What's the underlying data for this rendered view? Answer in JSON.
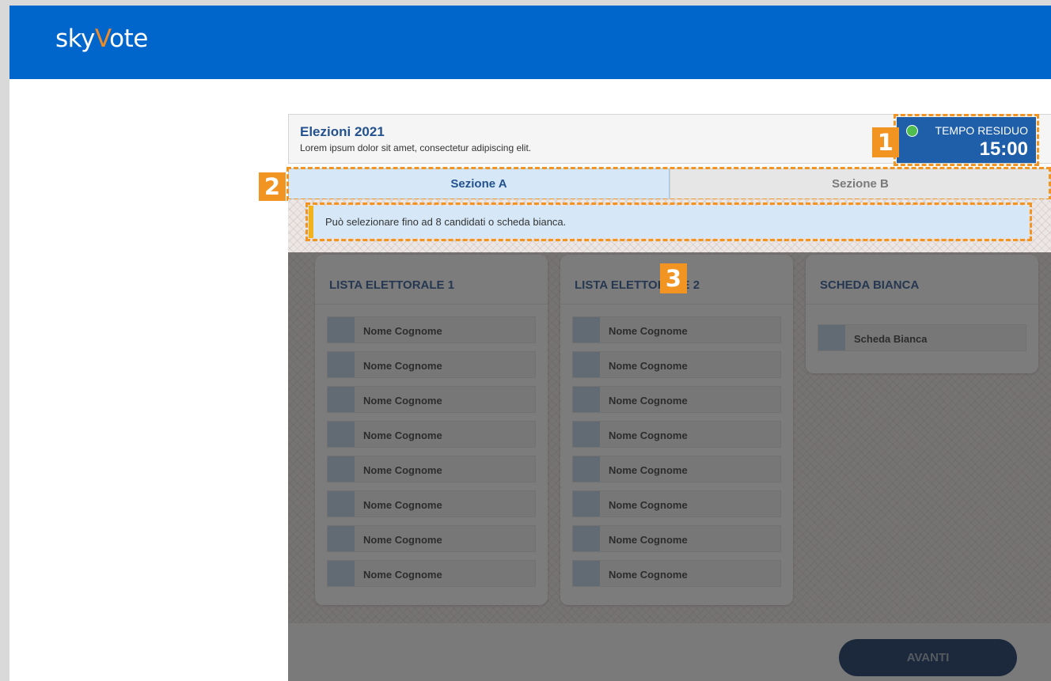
{
  "app": {
    "logo_main": "sky",
    "logo_accent": "V",
    "logo_tail": "ote"
  },
  "election": {
    "title": "Elezioni 2021",
    "subtitle": "Lorem ipsum dolor sit amet, consectetur adipiscing elit."
  },
  "timer": {
    "label": "TEMPO RESIDUO",
    "value": "15:00"
  },
  "tabs": [
    {
      "label": "Sezione A",
      "active": true
    },
    {
      "label": "Sezione B",
      "active": false
    }
  ],
  "info": {
    "text": "Può selezionare fino ad 8 candidati o scheda bianca."
  },
  "lists": [
    {
      "title": "LISTA ELETTORALE 1",
      "candidates": [
        "Nome Cognome",
        "Nome Cognome",
        "Nome Cognome",
        "Nome Cognome",
        "Nome Cognome",
        "Nome Cognome",
        "Nome Cognome",
        "Nome Cognome"
      ]
    },
    {
      "title": "LISTA ELETTORALE 2",
      "candidates": [
        "Nome Cognome",
        "Nome Cognome",
        "Nome Cognome",
        "Nome Cognome",
        "Nome Cognome",
        "Nome Cognome",
        "Nome Cognome",
        "Nome Cognome"
      ]
    }
  ],
  "blank": {
    "title": "SCHEDA BIANCA",
    "option": "Scheda Bianca"
  },
  "footer": {
    "next_label": "AVANTI"
  },
  "annotations": [
    "1",
    "2",
    "3"
  ],
  "colors": {
    "header": "#0066cc",
    "accent": "#f29422",
    "timer": "#1f5ea8",
    "title": "#23528f"
  }
}
